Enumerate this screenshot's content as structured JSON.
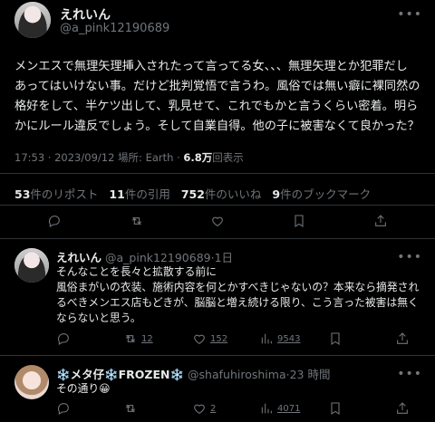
{
  "main_tweet": {
    "author_name": "えれいん",
    "author_handle": "@a_pink12190689",
    "text_lines": [
      "メンエスで無理矢理挿入されたって言ってる女、、、無理矢理とか犯罪だし",
      "あってはいけない事。だけど批判覚悟で言うわ。風俗では無い癖に裸同然の",
      "格好をして、半ケツ出して、乳見せて、これでもかと言うくらい密着。明ら",
      "かにルール違反でしょう。そして自業自得。他の子に被害なくて良かった？"
    ],
    "time": "17:53 · 2023/09/12 場所: Earth · ",
    "views_count": "6.8万",
    "views_label": "回表示",
    "stats": {
      "reposts_count": "53",
      "reposts_label": "件のリポスト",
      "quotes_count": "11",
      "quotes_label": "件の引用",
      "likes_count": "752",
      "likes_label": "件のいいね",
      "bookmarks_count": "9",
      "bookmarks_label": "件のブックマーク"
    }
  },
  "replies": [
    {
      "author_name": "えれいん",
      "author_handle": "@a_pink12190689",
      "time": "·1日",
      "text_lines": [
        "そんなことを長々と拡散する前に",
        "風俗まがいの衣装、施術内容を何とかすべきじゃないの？本来なら摘発され",
        "るべきメンエス店もどきが、脳脳と増え続ける限り、こう言った被害は無く",
        "ならないと思う。"
      ],
      "retweets": "12",
      "likes": "152",
      "views": "9543"
    },
    {
      "author_name_prefix": "❄️メタ仔❄️FROZEN❄️",
      "author_handle": "@shafuhiroshima",
      "time": "·23 時間",
      "text": "その通り😀",
      "retweets": "",
      "likes": "2",
      "views": "4071"
    }
  ],
  "icons": [
    "more-icon",
    "reply-icon",
    "retweet-icon",
    "like-icon",
    "bookmark-icon",
    "share-icon",
    "views-icon"
  ],
  "colors": {
    "background": "#000000",
    "text": "#e7e9ea",
    "muted": "#71767b",
    "divider": "#2f3336"
  }
}
